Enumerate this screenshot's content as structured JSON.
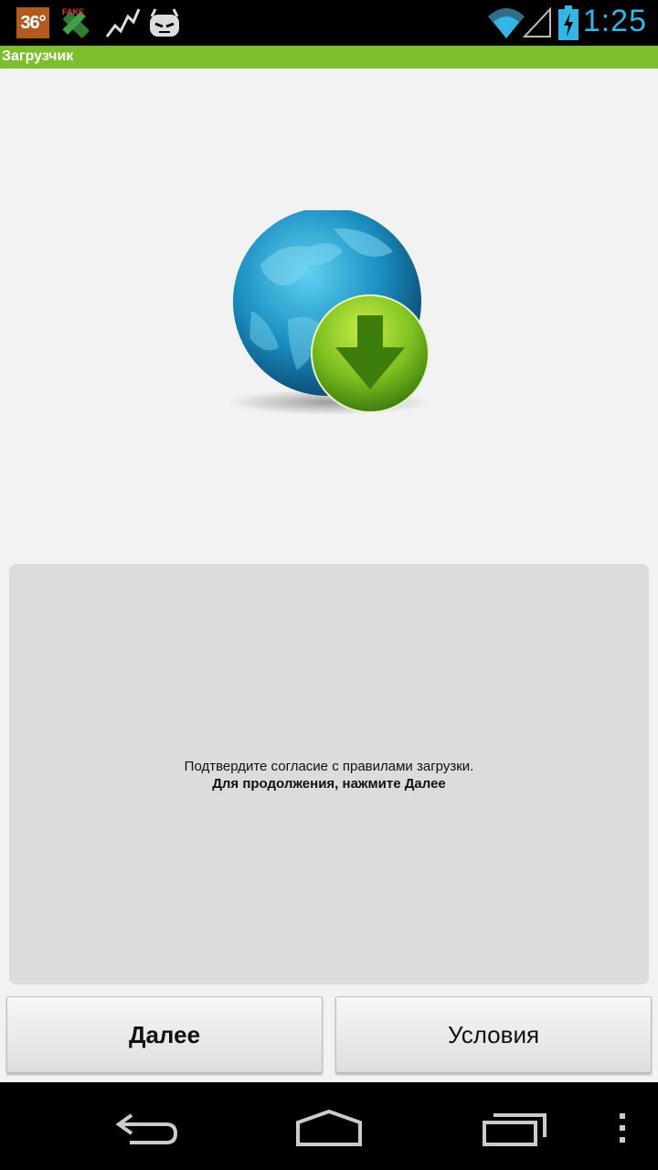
{
  "status_bar": {
    "temperature": "36°",
    "fake_label": "FAKE",
    "time": "1:25",
    "icons": [
      "temperature-badge",
      "fake-gps-icon",
      "activity-icon",
      "android-icon",
      "wifi-icon",
      "signal-icon",
      "battery-icon"
    ]
  },
  "app": {
    "title": "Загрузчик",
    "accent": "#7cbf2d"
  },
  "main": {
    "hero_icon": "globe-download-icon",
    "message_line1": "Подтвердите согласие с правилами загрузки.",
    "message_line2": "Для продолжения, нажмите Далее"
  },
  "buttons": {
    "next_label": "Далее",
    "terms_label": "Условия"
  },
  "nav": {
    "icons": [
      "back-icon",
      "home-icon",
      "recents-icon",
      "menu-icon"
    ]
  }
}
